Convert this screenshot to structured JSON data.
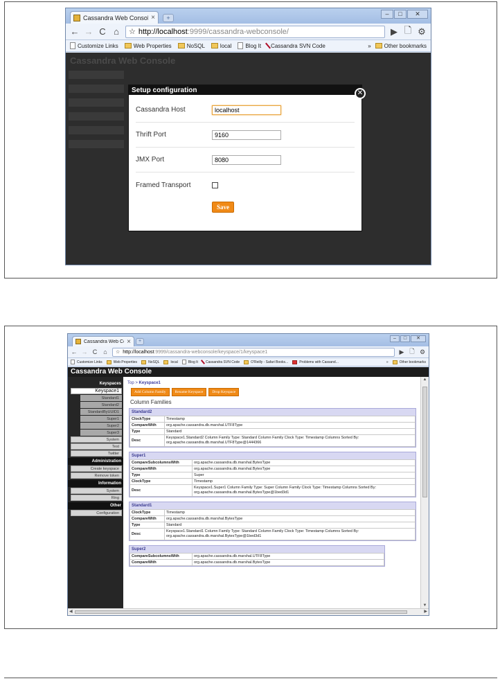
{
  "screen1": {
    "tab_title": "Cassandra Web Console",
    "url_host": "http://localhost",
    "url_path": ":9999/cassandra-webconsole/",
    "bookmarks": [
      "Customize Links",
      "Web Properties",
      "NoSQL",
      "local",
      "Blog It",
      "Cassandra SVN Code"
    ],
    "other_bookmarks": "Other bookmarks",
    "background_title": "Cassandra Web Console",
    "dialog": {
      "title": "Setup configuration",
      "fields": [
        {
          "label": "Cassandra Host",
          "value": "localhost"
        },
        {
          "label": "Thrift Port",
          "value": "9160"
        },
        {
          "label": "JMX Port",
          "value": "8080"
        }
      ],
      "framed_transport_label": "Framed Transport",
      "framed_transport_checked": false,
      "save_label": "Save"
    }
  },
  "screen2": {
    "tab_title": "Cassandra Web Console",
    "url_host": "http://localhost",
    "url_path": ":9999/cassandra-webconsole/keyspace/1/keyspace1",
    "bookmarks": [
      "Customize Links",
      "Web Properties",
      "NoSQL",
      "local",
      "Blog It",
      "Cassandra SVN Code",
      "O'Reilly - Safari Books...",
      "Problems with Cassand..."
    ],
    "other_bookmarks": "Other bookmarks",
    "app_title": "Cassandra Web Console",
    "sidebar": {
      "keyspaces_header": "Keyspaces",
      "keyspace_active": "Keyspace1",
      "keyspace1_cfs": [
        "Standard1",
        "Standard2",
        "StandardByUUID1",
        "Super1",
        "Super2",
        "Super3"
      ],
      "other_keyspaces": [
        "System",
        "Test",
        "Twitter"
      ],
      "administration_header": "Administration",
      "administration": [
        "Create keyspace",
        "Remove token"
      ],
      "information_header": "Information",
      "information": [
        "System",
        "Ring"
      ],
      "other_header": "Other",
      "other": [
        "Configuration"
      ]
    },
    "breadcrumb": {
      "top": "Top",
      "separator": " > ",
      "current": "Keyspace1"
    },
    "actions": [
      "Add Column Family",
      "Rename Keyspace",
      "Drop Keyspace"
    ],
    "column_families_title": "Column Families",
    "column_families": [
      {
        "name": "Standard2",
        "rows": [
          {
            "k": "ClockType",
            "v": "Timestamp"
          },
          {
            "k": "CompareWith",
            "v": "org.apache.cassandra.db.marshal.UTF8Type"
          },
          {
            "k": "Type",
            "v": "Standard"
          },
          {
            "k": "Desc",
            "v": "Keyspace1.Standard2 Column Family Type: Standard Column Family Clock Type: Timestamp Columns Sorted By: org.apache.cassandra.db.marshal.UTF8Type@1444366"
          }
        ]
      },
      {
        "name": "Super1",
        "rows": [
          {
            "k": "CompareSubcolumnsWith",
            "v": "org.apache.cassandra.db.marshal.BytesType"
          },
          {
            "k": "CompareWith",
            "v": "org.apache.cassandra.db.marshal.BytesType"
          },
          {
            "k": "Type",
            "v": "Super"
          },
          {
            "k": "ClockType",
            "v": "Timestamp"
          },
          {
            "k": "Desc",
            "v": "Keyspace1.Super1 Column Family Type: Super Column Family Clock Type: Timestamp Columns Sorted By: org.apache.cassandra.db.marshal.BytesType@1bed3d1"
          }
        ]
      },
      {
        "name": "Standard1",
        "rows": [
          {
            "k": "ClockType",
            "v": "Timestamp"
          },
          {
            "k": "CompareWith",
            "v": "org.apache.cassandra.db.marshal.BytesType"
          },
          {
            "k": "Type",
            "v": "Standard"
          },
          {
            "k": "Desc",
            "v": "Keyspace1.Standard1 Column Family Type: Standard Column Family Clock Type: Timestamp Columns Sorted By: org.apache.cassandra.db.marshal.BytesType@1bed3d1"
          }
        ]
      },
      {
        "name": "Super2",
        "rows": [
          {
            "k": "CompareSubcolumnsWith",
            "v": "org.apache.cassandra.db.marshal.UTF8Type"
          },
          {
            "k": "CompareWith",
            "v": "org.apache.cassandra.db.marshal.BytesType"
          }
        ]
      }
    ]
  }
}
